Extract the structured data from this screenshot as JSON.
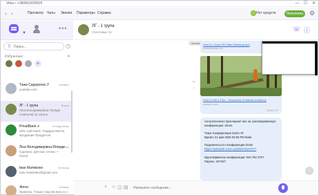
{
  "window": {
    "title": "Viber • +380663025825",
    "controls": [
      "—",
      "☐",
      "✕"
    ]
  },
  "menu": {
    "back": "‹",
    "forward": "›",
    "items": [
      "Просмотр",
      "Чаты",
      "Звонки",
      "Параметры",
      "Справка"
    ],
    "status": "Нет средств",
    "topup": "Пополнить"
  },
  "sidebar": {
    "search_placeholder": "Поиск...",
    "favorites_label": "Избранные",
    "chats": [
      {
        "name": "Тажа Сидоренко 2",
        "time": "Четверг",
        "preview": "youtube.com",
        "color": "#b0b8c8"
      },
      {
        "name": "ЛГ - 1 група",
        "time": "Вчера",
        "preview": "Лiна Володимирiвна Попаде покинула(-а) группу",
        "color": "#7a8a4a"
      },
      {
        "name": "PrivatBank ✔",
        "time": "Понедельник",
        "preview": "10% cash-back. Подарок Мечта продукции Продуктов",
        "color": "#2e8b3a"
      },
      {
        "name": "Лiна Володимирiвна Попаде",
        "time": "Понедельник",
        "preview": "Сделано. Для вас готово — #1015",
        "color": "#c8a07a"
      },
      {
        "name": "Іван Матвієнко",
        "time": "Пятница",
        "preview": "ivan.matvienko@gmail.com",
        "color": "#556070"
      },
      {
        "name": "Женя",
        "time": "Четверг",
        "preview": "Привіток. Тільки тому Ви його ж є",
        "color": "#d2b08a"
      }
    ]
  },
  "chat": {
    "title": "ЛГ - 1 група",
    "subtitle": "Участники: 21",
    "date_pill": "Четверг",
    "link1": "How-to: Cloud HD Video Meeting.mp4",
    "link1_src": "ecdcast.zoom.us",
    "link2": "How to Fell a Tree - Husqvarna Chainsaw Academy",
    "link2_src": "youtube.com",
    "time1": "13:55 ✔✔",
    "message_lines": [
      "Алла Бличенко приглашает вас на запланированную",
      "конференцию: Zoom.",
      "",
      "Тема: Конференция Zoom ЛГ",
      "Время: 21 мая 2020 04:00 PM Киев",
      "",
      "Подключиться к конференции Zoom",
      "https://us04web.zoom.us/j/6347923707?",
      "",
      "Идентификатор конференции: 634 792 3707",
      "Пароль: 247437"
    ],
    "composer_placeholder": "Напишите сообщение..."
  }
}
